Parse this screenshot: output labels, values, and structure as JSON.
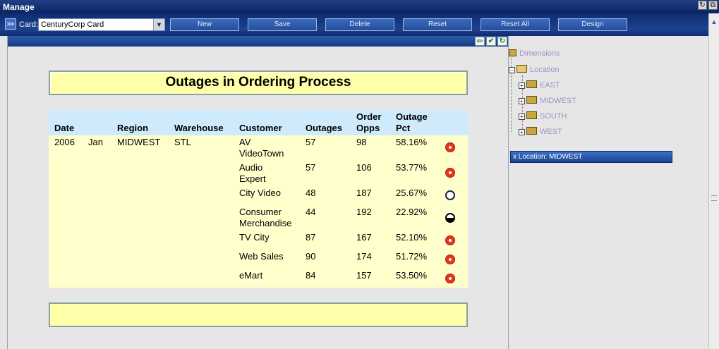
{
  "window": {
    "title": "Manage",
    "buttons": [
      "↻",
      "⧉"
    ]
  },
  "toolbar": {
    "expand_label": ">>",
    "card_label": "Card:",
    "card_value": "CenturyCorp Card",
    "buttons": [
      "New",
      "Save",
      "Delete",
      "Reset",
      "Reset All",
      "Design"
    ]
  },
  "panel_icons": [
    "⇦",
    "✔",
    "↻"
  ],
  "report": {
    "title": "Outages in Ordering Process",
    "columns": [
      "Date",
      "",
      "Region",
      "Warehouse",
      "Customer",
      "Outages",
      "Order Opps",
      "Outage Pct"
    ],
    "group": {
      "year": "2006",
      "month": "Jan",
      "region": "MIDWEST",
      "warehouse": "STL"
    },
    "rows": [
      {
        "customer": "AV VideoTown",
        "outages": "57",
        "opps": "98",
        "pct": "58.16%",
        "status": "red"
      },
      {
        "customer": "Audio Expert",
        "outages": "57",
        "opps": "106",
        "pct": "53.77%",
        "status": "red"
      },
      {
        "customer": "City Video",
        "outages": "48",
        "opps": "187",
        "pct": "25.67%",
        "status": "empty"
      },
      {
        "customer": "Consumer Merchandise",
        "outages": "44",
        "opps": "192",
        "pct": "22.92%",
        "status": "half"
      },
      {
        "customer": "TV City",
        "outages": "87",
        "opps": "167",
        "pct": "52.10%",
        "status": "red"
      },
      {
        "customer": "Web Sales",
        "outages": "90",
        "opps": "174",
        "pct": "51.72%",
        "status": "red"
      },
      {
        "customer": "eMart",
        "outages": "84",
        "opps": "157",
        "pct": "53.50%",
        "status": "red"
      }
    ]
  },
  "tree": {
    "root": "Dimensions",
    "location": "Location",
    "regions": [
      "EAST",
      "MIDWEST",
      "SOUTH",
      "WEST"
    ]
  },
  "filter": {
    "label": "x Location: MIDWEST"
  }
}
